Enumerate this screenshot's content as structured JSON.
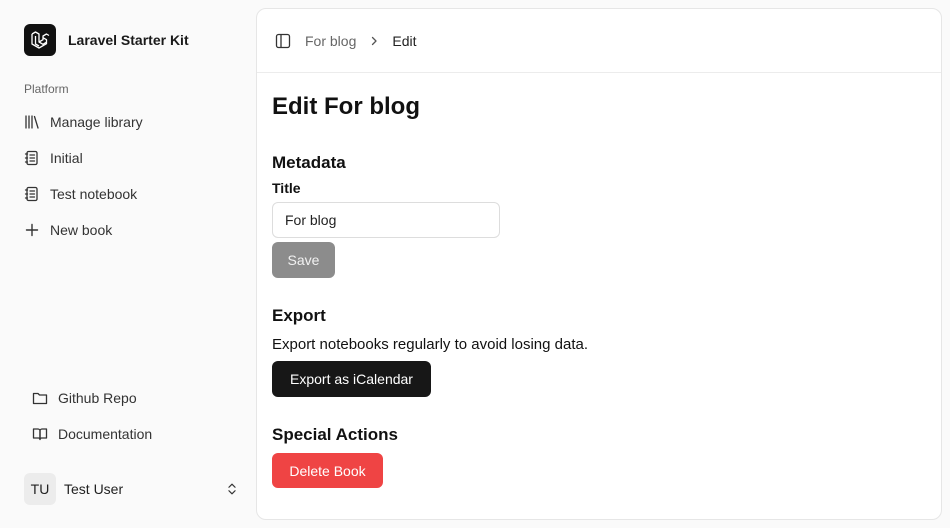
{
  "app": {
    "name": "Laravel Starter Kit",
    "logo_icon": "laravel-logo-icon"
  },
  "sidebar": {
    "group_label": "Platform",
    "items": [
      {
        "label": "Manage library",
        "icon": "library-icon"
      },
      {
        "label": "Initial",
        "icon": "notebook-icon"
      },
      {
        "label": "Test notebook",
        "icon": "notebook-icon"
      },
      {
        "label": "New book",
        "icon": "plus-icon"
      }
    ],
    "footer_links": [
      {
        "label": "Github Repo",
        "icon": "folder-icon"
      },
      {
        "label": "Documentation",
        "icon": "book-open-icon"
      }
    ],
    "user": {
      "initials": "TU",
      "name": "Test User"
    }
  },
  "header": {
    "breadcrumb": [
      {
        "label": "For blog"
      },
      {
        "label": "Edit"
      }
    ]
  },
  "main": {
    "title": "Edit For blog",
    "metadata": {
      "heading": "Metadata",
      "title_label": "Title",
      "title_value": "For blog",
      "save_label": "Save"
    },
    "export": {
      "heading": "Export",
      "description": "Export notebooks regularly to avoid losing data.",
      "button_label": "Export as iCalendar"
    },
    "special": {
      "heading": "Special Actions",
      "delete_label": "Delete Book"
    }
  },
  "colors": {
    "delete": "#ef4444",
    "primary": "#171717",
    "disabled": "#8c8c8c"
  }
}
